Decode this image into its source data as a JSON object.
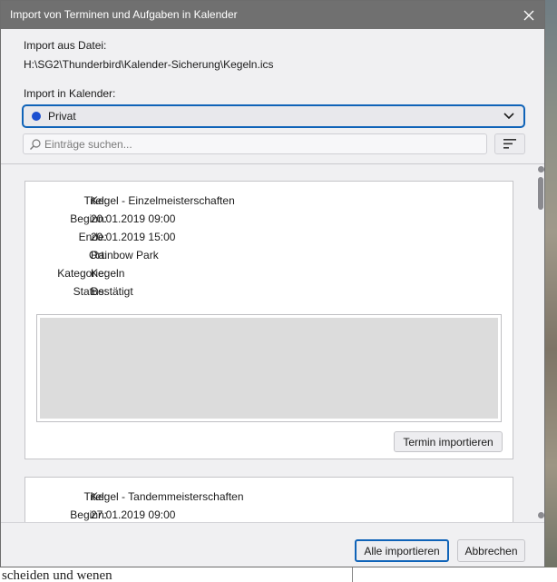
{
  "window": {
    "title": "Import von Terminen und Aufgaben in Kalender"
  },
  "import_file": {
    "label": "Import aus Datei:",
    "path": "H:\\SG2\\Thunderbird\\Kalender-Sicherung\\Kegeln.ics"
  },
  "calendar_select": {
    "label": "Import in Kalender:",
    "selected": "Privat",
    "dot_color": "#1b4fd0"
  },
  "search": {
    "placeholder": "Einträge suchen..."
  },
  "events": [
    {
      "fields": [
        {
          "key": "Titel:",
          "value": "Kegel - Einzelmeisterschaften"
        },
        {
          "key": "Beginn:",
          "value": "20.01.2019 09:00"
        },
        {
          "key": "Ende:",
          "value": "20.01.2019 15:00"
        },
        {
          "key": "Ort:",
          "value": "Rainbow Park"
        },
        {
          "key": "Kategorie:",
          "value": "Kegeln"
        },
        {
          "key": "Status:",
          "value": "Bestätigt"
        }
      ],
      "import_button": "Termin importieren"
    },
    {
      "fields": [
        {
          "key": "Titel:",
          "value": "Kegel - Tandemmeisterschaften"
        },
        {
          "key": "Beginn:",
          "value": "27.01.2019 09:00"
        }
      ]
    }
  ],
  "footer": {
    "import_all": "Alle importieren",
    "cancel": "Abbrechen"
  },
  "background": {
    "bottom_text": "scheiden und wenen"
  },
  "colors": {
    "accent": "#0f63b8",
    "titlebar": "#707070"
  }
}
